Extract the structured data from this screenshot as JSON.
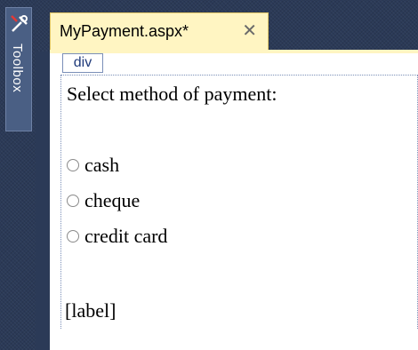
{
  "toolbox": {
    "label": "Toolbox",
    "icon": "toolbox-icon"
  },
  "editor": {
    "tab_title": "MyPayment.aspx*",
    "tab_close": "✕",
    "element_tag": "div"
  },
  "form": {
    "prompt": "Select method of payment:",
    "options": [
      "cash",
      "cheque",
      "credit card"
    ],
    "label": "[label]"
  },
  "colors": {
    "tab_background": "#fff5c2",
    "chrome_background": "#2b3a57",
    "selection_border": "#7b8fb8"
  }
}
